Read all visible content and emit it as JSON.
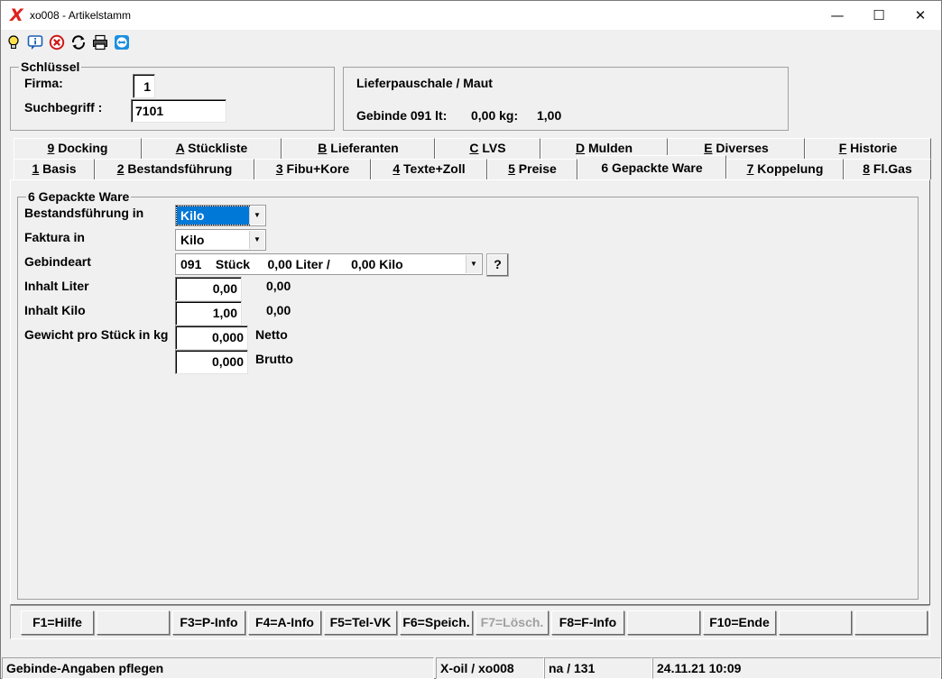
{
  "window": {
    "title": "xo008 - Artikelstamm",
    "logo": "X",
    "controls": {
      "minimize": "—",
      "maximize": "☐",
      "close": "✕"
    }
  },
  "toolbar": {
    "icons": [
      "lightbulb-icon",
      "info-icon",
      "cancel-icon",
      "refresh-icon",
      "print-icon",
      "teamviewer-icon"
    ]
  },
  "schluessel": {
    "legend": "Schlüssel",
    "firma_label": "Firma:",
    "firma_value": "1",
    "suchbegriff_label": "Suchbegriff :",
    "suchbegriff_value": "7101"
  },
  "lieferpauschale": {
    "title": "Lieferpauschale / Maut",
    "gebinde_label": "Gebinde 091 lt:",
    "kg_label": "0,00 kg:",
    "value": "1,00"
  },
  "tabs_row1": [
    {
      "hotkey": "9",
      "label": " Docking"
    },
    {
      "hotkey": "A",
      "label": " Stückliste"
    },
    {
      "hotkey": "B",
      "label": " Lieferanten"
    },
    {
      "hotkey": "C",
      "label": " LVS"
    },
    {
      "hotkey": "D",
      "label": " Mulden"
    },
    {
      "hotkey": "E",
      "label": " Diverses"
    },
    {
      "hotkey": "F",
      "label": " Historie"
    }
  ],
  "tabs_row2": [
    {
      "hotkey": "1",
      "label": " Basis"
    },
    {
      "hotkey": "2",
      "label": " Bestandsführung"
    },
    {
      "hotkey": "3",
      "label": " Fibu+Kore"
    },
    {
      "hotkey": "4",
      "label": " Texte+Zoll"
    },
    {
      "hotkey": "5",
      "label": " Preise"
    },
    {
      "hotkey": "",
      "label": "6 Gepackte Ware"
    },
    {
      "hotkey": "7",
      "label": " Koppelung"
    },
    {
      "hotkey": "8",
      "label": " Fl.Gas"
    }
  ],
  "gepackte_ware": {
    "legend": "6 Gepackte Ware",
    "bestandsfuehrung_label": "Bestandsführung in",
    "bestandsfuehrung_value": "Kilo",
    "faktura_label": "Faktura in",
    "faktura_value": "Kilo",
    "gebindeart_label": "Gebindeart",
    "gebindeart_value": "091    Stück     0,00 Liter /      0,00 Kilo",
    "help_button": "?",
    "inhalt_liter_label": "Inhalt Liter",
    "inhalt_liter_value": "0,00",
    "inhalt_liter_extra": "0,00",
    "inhalt_kilo_label": "Inhalt Kilo",
    "inhalt_kilo_value": "1,00",
    "inhalt_kilo_extra": "0,00",
    "gewicht_label": "Gewicht pro Stück in kg",
    "netto_value": "0,000",
    "netto_label": "Netto",
    "brutto_value": "0,000",
    "brutto_label": "Brutto"
  },
  "function_keys": [
    {
      "label": "F1=Hilfe",
      "enabled": true
    },
    {
      "label": "",
      "enabled": true
    },
    {
      "label": "F3=P-Info",
      "enabled": true
    },
    {
      "label": "F4=A-Info",
      "enabled": true
    },
    {
      "label": "F5=Tel-VK",
      "enabled": true
    },
    {
      "label": "F6=Speich.",
      "enabled": true
    },
    {
      "label": "F7=Lösch.",
      "enabled": false
    },
    {
      "label": "F8=F-Info",
      "enabled": true
    },
    {
      "label": "",
      "enabled": true
    },
    {
      "label": "F10=Ende",
      "enabled": true
    },
    {
      "label": "",
      "enabled": true
    },
    {
      "label": "",
      "enabled": true
    }
  ],
  "statusbar": {
    "message": "Gebinde-Angaben pflegen",
    "system": "X-oil / xo008",
    "user": "na / 131",
    "datetime": "24.11.21 10:09"
  }
}
